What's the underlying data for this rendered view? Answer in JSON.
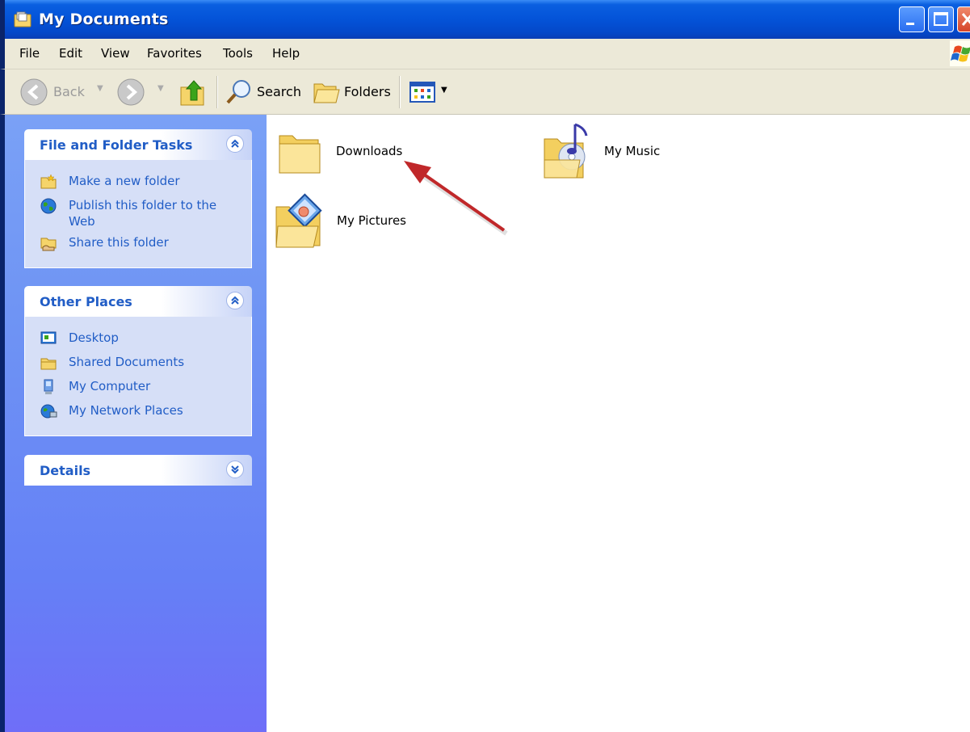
{
  "window": {
    "title": "My Documents"
  },
  "menu": [
    "File",
    "Edit",
    "View",
    "Favorites",
    "Tools",
    "Help"
  ],
  "toolbar": {
    "back_label": "Back",
    "search_label": "Search",
    "folders_label": "Folders"
  },
  "panels": {
    "file_tasks": {
      "title": "File and Folder Tasks",
      "items": [
        {
          "label": "Make a new folder",
          "icon": "new-folder-icon"
        },
        {
          "label": "Publish this folder to the Web",
          "icon": "globe-icon"
        },
        {
          "label": "Share this folder",
          "icon": "share-folder-icon"
        }
      ]
    },
    "other_places": {
      "title": "Other Places",
      "items": [
        {
          "label": "Desktop",
          "icon": "desktop-icon"
        },
        {
          "label": "Shared Documents",
          "icon": "folder-icon"
        },
        {
          "label": "My Computer",
          "icon": "computer-icon"
        },
        {
          "label": "My Network Places",
          "icon": "network-places-icon"
        }
      ]
    },
    "details": {
      "title": "Details"
    }
  },
  "content": {
    "items": [
      {
        "label": "Downloads",
        "icon": "folder-icon"
      },
      {
        "label": "My Music",
        "icon": "music-folder-icon"
      },
      {
        "label": "My Pictures",
        "icon": "pictures-folder-icon"
      }
    ]
  },
  "colors": {
    "title_bar": "#0453d8",
    "task_pane_top": "#7aa1f6",
    "task_pane_bottom": "#6f6ef8",
    "link_blue": "#215dc6",
    "annotation_arrow": "#c0282a"
  }
}
